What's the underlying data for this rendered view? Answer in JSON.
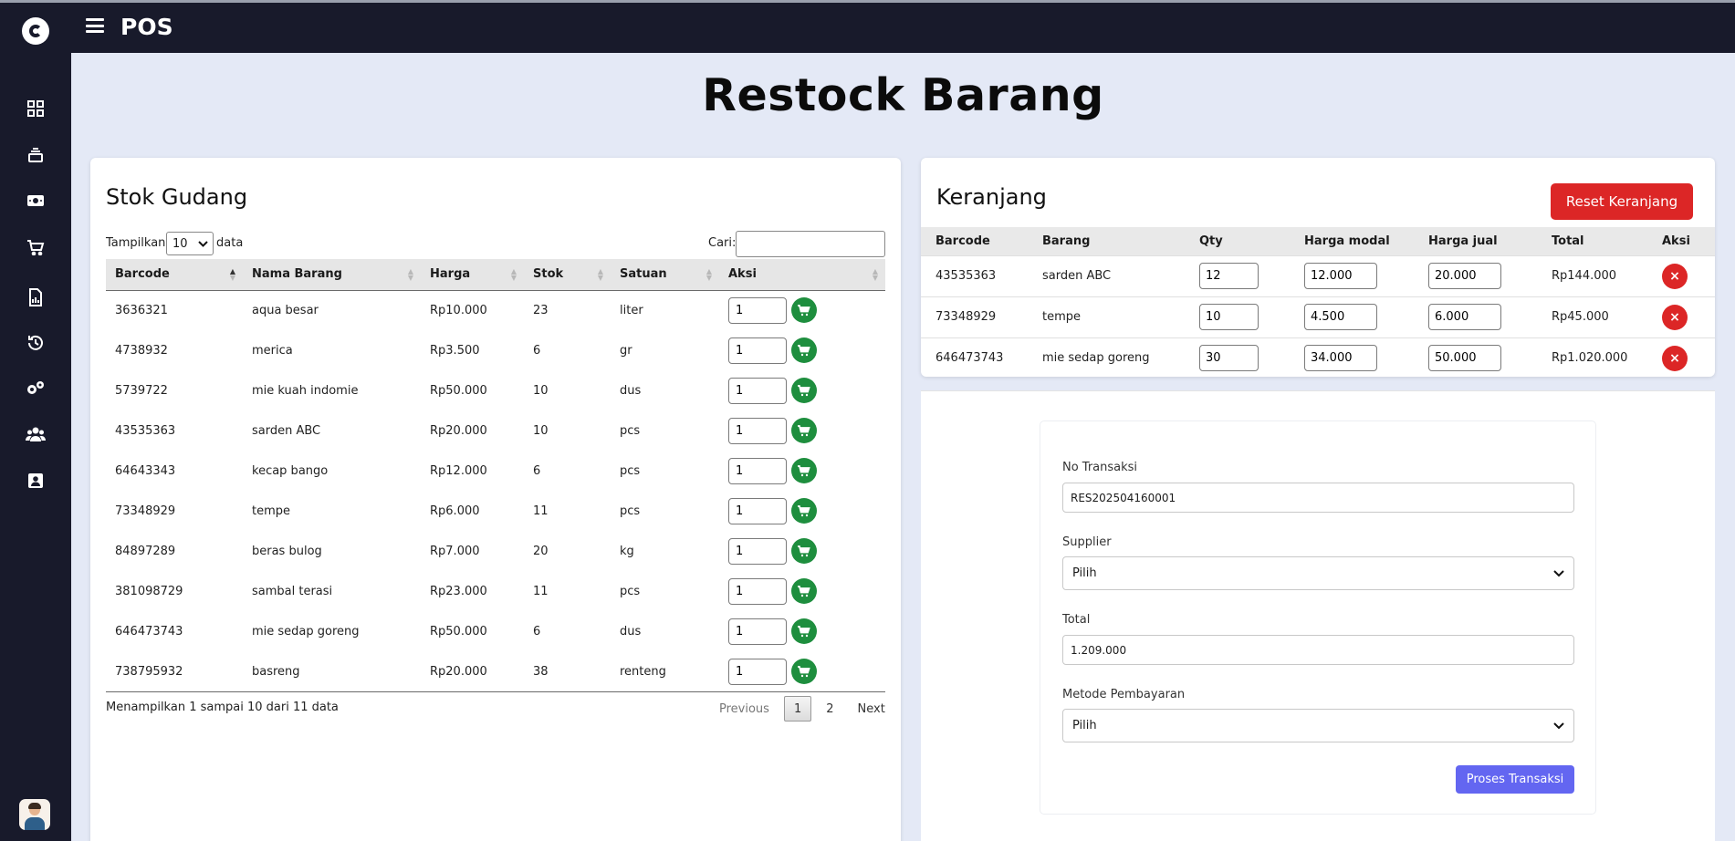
{
  "app": {
    "title": "POS"
  },
  "page": {
    "title": "Restock Barang"
  },
  "sidebar": {
    "items": [
      {
        "icon": "dashboard-icon"
      },
      {
        "icon": "layers-icon"
      },
      {
        "icon": "cash-icon"
      },
      {
        "icon": "cart-icon"
      },
      {
        "icon": "report-icon"
      },
      {
        "icon": "history-icon"
      },
      {
        "icon": "settings-icon"
      },
      {
        "icon": "users-icon"
      },
      {
        "icon": "contact-icon"
      }
    ]
  },
  "stock": {
    "title": "Stok Gudang",
    "length_prefix": "Tampilkan",
    "length_value": "10",
    "length_suffix": "data",
    "search_label": "Cari:",
    "search_value": "",
    "columns": [
      "Barcode",
      "Nama Barang",
      "Harga",
      "Stok",
      "Satuan",
      "Aksi"
    ],
    "rows": [
      {
        "barcode": "3636321",
        "name": "aqua besar",
        "price": "Rp10.000",
        "stock": "23",
        "unit": "liter",
        "qty": "1"
      },
      {
        "barcode": "4738932",
        "name": "merica",
        "price": "Rp3.500",
        "stock": "6",
        "unit": "gr",
        "qty": "1"
      },
      {
        "barcode": "5739722",
        "name": "mie kuah indomie",
        "price": "Rp50.000",
        "stock": "10",
        "unit": "dus",
        "qty": "1"
      },
      {
        "barcode": "43535363",
        "name": "sarden ABC",
        "price": "Rp20.000",
        "stock": "10",
        "unit": "pcs",
        "qty": "1"
      },
      {
        "barcode": "64643343",
        "name": "kecap bango",
        "price": "Rp12.000",
        "stock": "6",
        "unit": "pcs",
        "qty": "1"
      },
      {
        "barcode": "73348929",
        "name": "tempe",
        "price": "Rp6.000",
        "stock": "11",
        "unit": "pcs",
        "qty": "1"
      },
      {
        "barcode": "84897289",
        "name": "beras bulog",
        "price": "Rp7.000",
        "stock": "20",
        "unit": "kg",
        "qty": "1"
      },
      {
        "barcode": "381098729",
        "name": "sambal terasi",
        "price": "Rp23.000",
        "stock": "11",
        "unit": "pcs",
        "qty": "1"
      },
      {
        "barcode": "646473743",
        "name": "mie sedap goreng",
        "price": "Rp50.000",
        "stock": "6",
        "unit": "dus",
        "qty": "1"
      },
      {
        "barcode": "738795932",
        "name": "basreng",
        "price": "Rp20.000",
        "stock": "38",
        "unit": "renteng",
        "qty": "1"
      }
    ],
    "info": "Menampilkan 1 sampai 10 dari 11 data",
    "pagination": {
      "previous": "Previous",
      "pages": [
        "1",
        "2"
      ],
      "current": "1",
      "next": "Next"
    }
  },
  "cart": {
    "title": "Keranjang",
    "reset_label": "Reset Keranjang",
    "columns": [
      "Barcode",
      "Barang",
      "Qty",
      "Harga modal",
      "Harga jual",
      "Total",
      "Aksi"
    ],
    "rows": [
      {
        "barcode": "43535363",
        "name": "sarden ABC",
        "qty": "12",
        "cost": "12.000",
        "sell": "20.000",
        "total": "Rp144.000",
        "action": "×"
      },
      {
        "barcode": "73348929",
        "name": "tempe",
        "qty": "10",
        "cost": "4.500",
        "sell": "6.000",
        "total": "Rp45.000",
        "action": "×"
      },
      {
        "barcode": "646473743",
        "name": "mie sedap goreng",
        "qty": "30",
        "cost": "34.000",
        "sell": "50.000",
        "total": "Rp1.020.000",
        "action": "×"
      }
    ]
  },
  "form": {
    "no_label": "No Transaksi",
    "no_value": "RES202504160001",
    "supplier_label": "Supplier",
    "supplier_value": "Pilih",
    "total_label": "Total",
    "total_value": "1.209.000",
    "method_label": "Metode Pembayaran",
    "method_value": "Pilih",
    "submit_label": "Proses Transaksi"
  },
  "colors": {
    "sidebar": "#181a2b",
    "background": "#e4e9f6",
    "cart_button": "#1e8e3e",
    "danger": "#dc2626",
    "primary": "#6366f1"
  }
}
